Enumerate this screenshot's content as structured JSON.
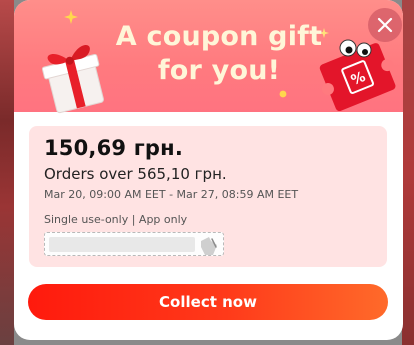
{
  "popup": {
    "title_line1": "A coupon gift",
    "title_line2": "for you!",
    "close_icon": "close-icon"
  },
  "coupon": {
    "amount": "150,69 грн.",
    "condition": "Orders over 565,10 грн.",
    "validity": "Mar 20, 09:00 AM EET - Mar 27, 08:59 AM EET",
    "restrictions": "Single use-only | App only"
  },
  "actions": {
    "collect_label": "Collect now"
  },
  "colors": {
    "header_pink": "#ff7a7f",
    "card_bg": "#ffe3e3",
    "button_red": "#ff1a0d",
    "button_orange": "#ff6a2a",
    "title_cream": "#fff6d8"
  }
}
